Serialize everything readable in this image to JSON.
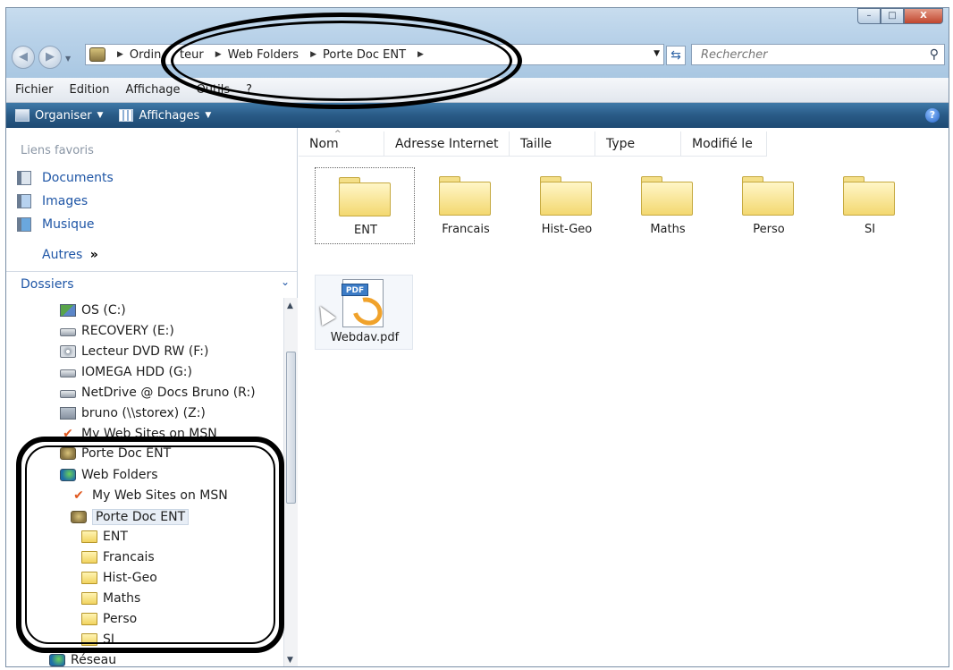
{
  "window": {
    "buttons": {
      "minimize": "–",
      "maximize": "□",
      "close": "X"
    }
  },
  "address": {
    "crumbs": [
      "Ordinateur",
      "Web Folders",
      "Porte Doc ENT"
    ],
    "crumb_visible_0": "Ordin     teur"
  },
  "search": {
    "placeholder": "Rechercher"
  },
  "menu": [
    "Fichier",
    "Edition",
    "Affichage",
    "Outils",
    "?"
  ],
  "commands": {
    "organize": "Organiser",
    "views": "Affichages"
  },
  "favorites": {
    "title": "Liens favoris",
    "items": [
      "Documents",
      "Images",
      "Musique"
    ],
    "more": "Autres",
    "more_glyph": "»"
  },
  "folders": {
    "title": "Dossiers",
    "tree": [
      {
        "label": "OS (C:)",
        "icon": "os-drive-icon"
      },
      {
        "label": "RECOVERY (E:)",
        "icon": "drive-icon"
      },
      {
        "label": "Lecteur DVD RW (F:)",
        "icon": "dvd-drive-icon"
      },
      {
        "label": "IOMEGA HDD (G:)",
        "icon": "drive-icon"
      },
      {
        "label": "NetDrive @ Docs Bruno (R:)",
        "icon": "drive-icon"
      },
      {
        "label": "bruno (\\\\storex) (Z:)",
        "icon": "disconnected-network-drive-icon"
      },
      {
        "label": "My Web Sites on MSN",
        "icon": "msn-icon"
      },
      {
        "label": "Porte Doc ENT",
        "icon": "webfolder-icon"
      },
      {
        "label": "Web Folders",
        "icon": "web-folders-icon"
      },
      {
        "label": "My Web Sites on MSN",
        "icon": "msn-icon"
      },
      {
        "label": "Porte Doc ENT",
        "icon": "webfolder-icon"
      },
      {
        "label": "ENT",
        "icon": "folder-icon"
      },
      {
        "label": "Francais",
        "icon": "folder-icon"
      },
      {
        "label": "Hist-Geo",
        "icon": "folder-icon"
      },
      {
        "label": "Maths",
        "icon": "folder-icon"
      },
      {
        "label": "Perso",
        "icon": "folder-icon"
      },
      {
        "label": "SI",
        "icon": "folder-icon"
      },
      {
        "label": "Réseau",
        "icon": "network-icon"
      }
    ]
  },
  "columns": [
    "Nom",
    "Adresse Internet",
    "Taille",
    "Type",
    "Modifié le"
  ],
  "items": {
    "folders": [
      "ENT",
      "Francais",
      "Hist-Geo",
      "Maths",
      "Perso",
      "SI"
    ],
    "file": {
      "name": "Webdav.pdf",
      "badge": "PDF"
    }
  },
  "colors": {
    "command_bar": "#295a86",
    "link": "#1f56a6",
    "folder": "#f3d870"
  }
}
